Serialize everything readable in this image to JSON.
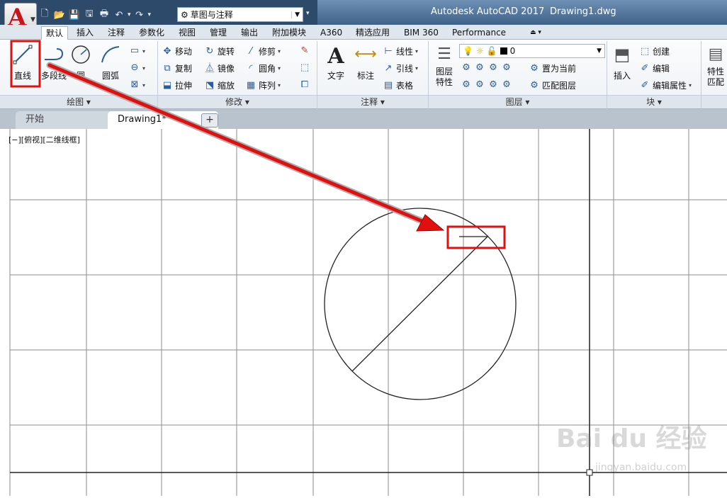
{
  "titlebar": {
    "app_title": "Autodesk AutoCAD 2017",
    "doc_title": "Drawing1.dwg",
    "app_button": "A",
    "workspace": "草图与注释",
    "qat_icons": [
      "new-icon",
      "open-icon",
      "save-icon",
      "save-as-icon",
      "plot-icon",
      "undo-icon",
      "redo-icon"
    ]
  },
  "ribbon_tabs": [
    "默认",
    "插入",
    "注释",
    "参数化",
    "视图",
    "管理",
    "输出",
    "附加模块",
    "A360",
    "精选应用",
    "BIM 360",
    "Performance"
  ],
  "ribbon": {
    "draw": {
      "title": "绘图",
      "line": "直线",
      "polyline": "多段线",
      "circle": "圆",
      "arc": "圆弧"
    },
    "modify": {
      "title": "修改",
      "move": "移动",
      "rotate": "旋转",
      "trim": "修剪",
      "copy": "复制",
      "mirror": "镜像",
      "fillet": "圆角",
      "stretch": "拉伸",
      "scale": "缩放",
      "array": "阵列"
    },
    "annotation": {
      "title": "注释",
      "text": "文字",
      "dimension": "标注",
      "linear": "线性",
      "leader": "引线",
      "table": "表格"
    },
    "layers": {
      "title": "图层",
      "layer_props_1": "图层",
      "layer_props_2": "特性",
      "current_layer": "0",
      "set_current": "置为当前",
      "match_layer": "匹配图层"
    },
    "block": {
      "title": "块",
      "insert": "插入",
      "create": "创建",
      "edit": "编辑",
      "edit_attr": "编辑属性"
    },
    "properties": {
      "label_1": "特性",
      "label_2": "匹配"
    }
  },
  "doc_tabs": {
    "start": "开始",
    "drawing": "Drawing1*",
    "add": "+"
  },
  "viewport": {
    "label": "[−][俯视][二维线框]"
  },
  "watermark": {
    "main": "Bai du 经验",
    "sub": "jingyan.baidu.com"
  },
  "colors": {
    "highlight": "#e01010",
    "titlebar": "#2e4a6b",
    "ribbon_icon": "#2a5d9c"
  }
}
